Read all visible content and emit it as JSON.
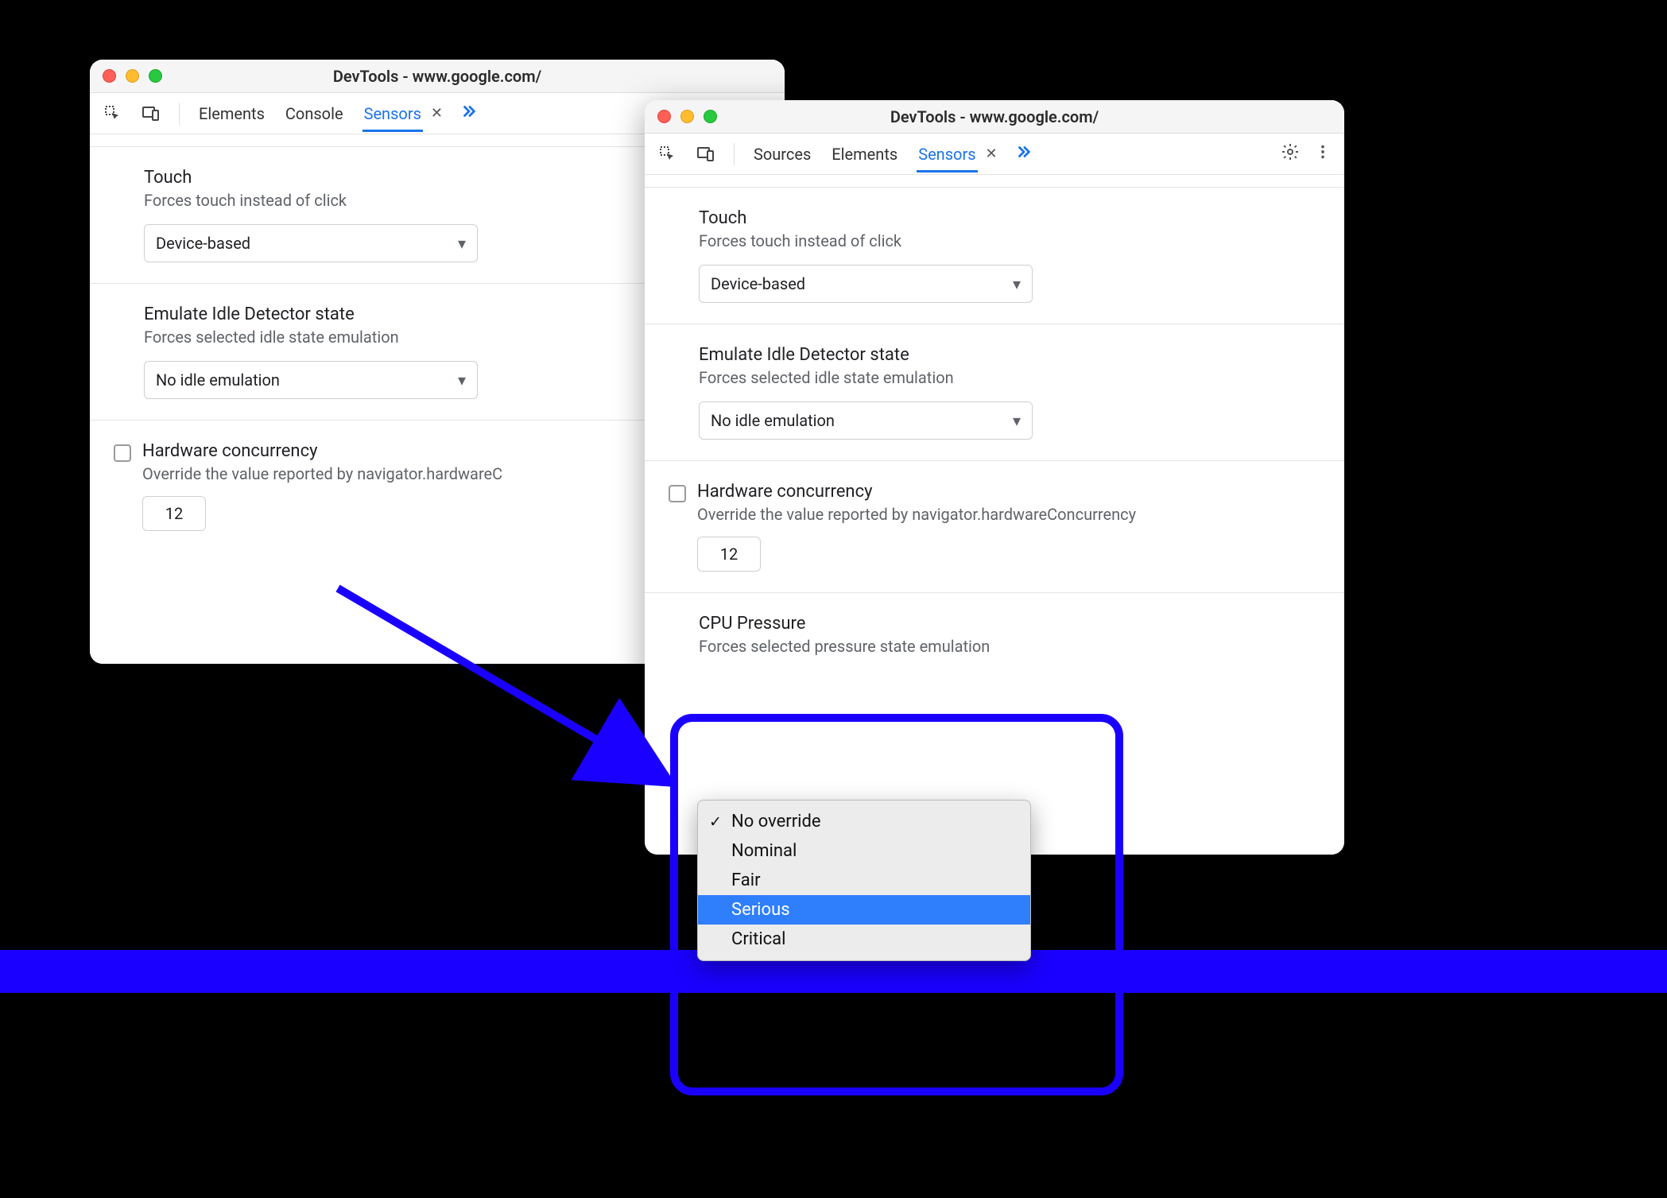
{
  "left": {
    "title": "DevTools - www.google.com/",
    "tabs": [
      "Elements",
      "Console",
      "Sensors"
    ],
    "activeTab": "Sensors",
    "touch": {
      "title": "Touch",
      "sub": "Forces touch instead of click",
      "value": "Device-based"
    },
    "idle": {
      "title": "Emulate Idle Detector state",
      "sub": "Forces selected idle state emulation",
      "value": "No idle emulation"
    },
    "hw": {
      "title": "Hardware concurrency",
      "sub": "Override the value reported by navigator.hardwareC",
      "value": "12"
    }
  },
  "right": {
    "title": "DevTools - www.google.com/",
    "tabs": [
      "Sources",
      "Elements",
      "Sensors"
    ],
    "activeTab": "Sensors",
    "touch": {
      "title": "Touch",
      "sub": "Forces touch instead of click",
      "value": "Device-based"
    },
    "idle": {
      "title": "Emulate Idle Detector state",
      "sub": "Forces selected idle state emulation",
      "value": "No idle emulation"
    },
    "hw": {
      "title": "Hardware concurrency",
      "sub": "Override the value reported by navigator.hardwareConcurrency",
      "value": "12"
    },
    "cpu": {
      "title": "CPU Pressure",
      "sub": "Forces selected pressure state emulation",
      "options": [
        "No override",
        "Nominal",
        "Fair",
        "Serious",
        "Critical"
      ],
      "selected": "No override",
      "hovered": "Serious"
    }
  }
}
